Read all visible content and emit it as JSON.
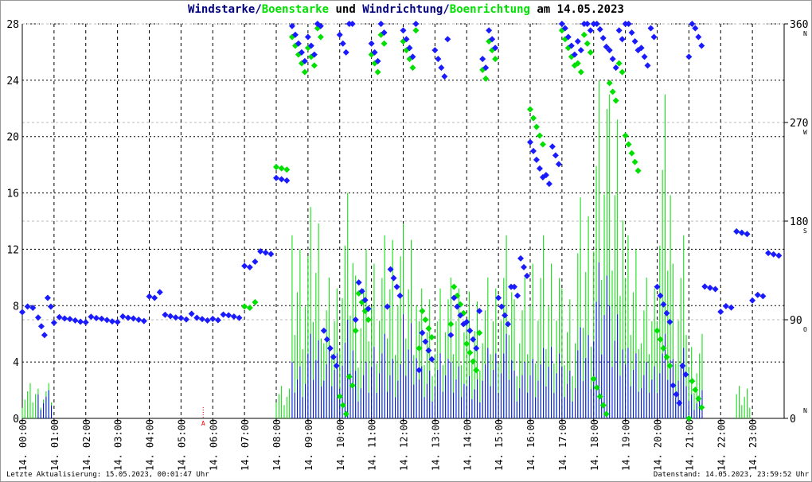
{
  "title": {
    "part1": "Windstarke/",
    "part2": "Boenstarke",
    "part3": " und ",
    "part4": "Windrichtung/",
    "part5": "Boenrichtung",
    "part6": " am 14.05.2023"
  },
  "footer": {
    "last_update": "Letzte Aktualisierung: 15.05.2023, 00:01:47 Uhr",
    "data_state": "Datenstand: 14.05.2023, 23:59:52 Uhr"
  },
  "colors": {
    "speed": "#0000ff",
    "gust": "#00e000",
    "direction": "#1a1aff",
    "gust_direction": "#00e000",
    "marker": "#ff0000",
    "title_navy": "#000080"
  },
  "chart_data": {
    "type": "line+scatter",
    "title": "Windstarke/Boenstarke und Windrichtung/Boenrichtung am 14.05.2023",
    "ylim": [
      0,
      28
    ],
    "y_ticks": [
      "0",
      "4",
      "8",
      "12",
      "16",
      "20",
      "24",
      "28"
    ],
    "y2lim": [
      0,
      360
    ],
    "y2_ticks": [
      "0",
      "90",
      "180",
      "270",
      "360"
    ],
    "y2_compass": [
      "N",
      "O",
      "S",
      "W",
      "N"
    ],
    "x_ticks": [
      "14. 00:00",
      "14. 01:00",
      "14. 02:00",
      "14. 03:00",
      "14. 04:00",
      "14. 05:00",
      "14. 06:00",
      "14. 07:00",
      "14. 08:00",
      "14. 09:00",
      "14. 10:00",
      "14. 11:00",
      "14. 12:00",
      "14. 13:00",
      "14. 14:00",
      "14. 15:00",
      "14. 16:00",
      "14. 17:00",
      "14. 18:00",
      "14. 19:00",
      "14. 20:00",
      "14. 21:00",
      "14. 22:00",
      "14. 23:00"
    ],
    "grid": true,
    "marker_label": "A",
    "marker_time": "05:42",
    "times": [
      "00:00",
      "00:30",
      "01:00",
      "01:30",
      "02:00",
      "02:30",
      "03:00",
      "03:30",
      "04:00",
      "04:30",
      "05:00",
      "05:30",
      "06:00",
      "06:30",
      "07:00",
      "07:30",
      "08:00",
      "08:30",
      "09:00",
      "09:30",
      "10:00",
      "10:30",
      "11:00",
      "11:30",
      "12:00",
      "12:30",
      "13:00",
      "13:30",
      "14:00",
      "14:30",
      "15:00",
      "15:30",
      "16:00",
      "16:30",
      "17:00",
      "17:30",
      "18:00",
      "18:30",
      "19:00",
      "19:30",
      "20:00",
      "20:30",
      "21:00",
      "21:30",
      "22:00",
      "22:30",
      "23:00",
      "23:30"
    ],
    "series": [
      {
        "name": "Windstarke",
        "axis": "left",
        "values": [
          0,
          2,
          0,
          0,
          0,
          0,
          0,
          0,
          0,
          0,
          0,
          0,
          0,
          0,
          0,
          0,
          0,
          4,
          6,
          5,
          7,
          4,
          6,
          5,
          8,
          4,
          5,
          4,
          3,
          5,
          6,
          4,
          5,
          6,
          4,
          7,
          12,
          8,
          5,
          4,
          6,
          5,
          2,
          0,
          0,
          0,
          0,
          0
        ]
      },
      {
        "name": "Boenstarke",
        "axis": "left",
        "values": [
          2.5,
          2.5,
          0,
          0,
          0,
          0,
          0,
          0,
          0,
          0,
          0,
          0,
          0,
          0,
          0,
          0,
          2.5,
          13,
          15,
          10,
          16,
          12,
          13,
          15,
          15,
          10,
          10,
          10,
          9,
          10,
          13,
          10,
          13,
          13,
          10,
          17,
          26,
          23,
          13,
          10,
          23,
          13,
          6,
          0,
          0,
          2.5,
          0,
          0
        ]
      },
      {
        "name": "Windrichtung",
        "axis": "right",
        "values": [
          100,
          90,
          90,
          90,
          90,
          90,
          90,
          90,
          113,
          93,
          93,
          90,
          92,
          92,
          140,
          150,
          220,
          340,
          350,
          60,
          350,
          110,
          340,
          120,
          350,
          60,
          330,
          90,
          80,
          340,
          100,
          130,
          240,
          230,
          350,
          350,
          355,
          340,
          350,
          340,
          100,
          30,
          350,
          120,
          100,
          170,
          110,
          150
        ]
      },
      {
        "name": "Boenrichtung",
        "axis": "right",
        "values": [
          null,
          null,
          null,
          null,
          null,
          null,
          null,
          null,
          null,
          null,
          null,
          null,
          null,
          null,
          103,
          null,
          230,
          330,
          340,
          null,
          20,
          100,
          330,
          null,
          340,
          80,
          null,
          100,
          60,
          330,
          null,
          null,
          270,
          null,
          340,
          330,
          20,
          310,
          240,
          null,
          60,
          null,
          20,
          null,
          null,
          170,
          null,
          null
        ]
      }
    ]
  }
}
